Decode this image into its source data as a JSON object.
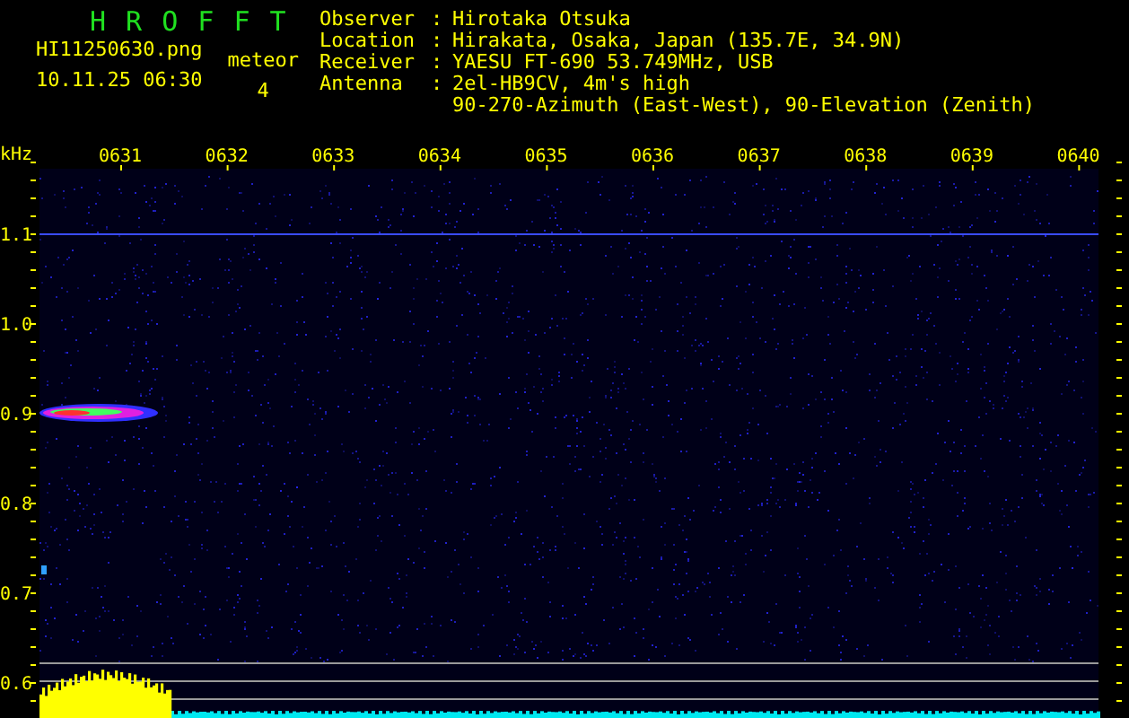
{
  "app_title": "H R O F F T",
  "file_name": "HI11250630.png",
  "date_time": "10.11.25 06:30",
  "meteor": {
    "label": "meteor",
    "count": "4"
  },
  "station_info": [
    {
      "label": "Observer",
      "sep": ":",
      "value": "Hirotaka Otsuka"
    },
    {
      "label": "Location",
      "sep": ":",
      "value": "Hirakata, Osaka, Japan (135.7E, 34.9N)"
    },
    {
      "label": "Receiver",
      "sep": ":",
      "value": "YAESU FT-690 53.749MHz, USB"
    },
    {
      "label": "Antenna",
      "sep": ":",
      "value": "2el-HB9CV, 4m's high"
    },
    {
      "value": "90-270-Azimuth (East-West), 90-Elevation (Zenith)"
    }
  ],
  "axis": {
    "unit": "kHz",
    "time_ticks": [
      "0631",
      "0632",
      "0633",
      "0634",
      "0635",
      "0636",
      "0637",
      "0638",
      "0639",
      "0640"
    ],
    "freq_ticks": [
      "1.1",
      "1.0",
      "0.9",
      "0.8",
      "0.7",
      "0.6"
    ]
  }
}
